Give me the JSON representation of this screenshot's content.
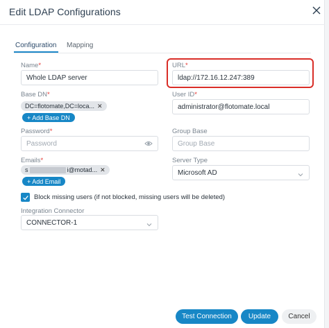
{
  "dialog": {
    "title": "Edit LDAP Configurations",
    "tabs": [
      {
        "label": "Configuration",
        "active": true
      },
      {
        "label": "Mapping",
        "active": false
      }
    ]
  },
  "form": {
    "name": {
      "label": "Name",
      "required_mark": "*",
      "value": "Whole LDAP server"
    },
    "url": {
      "label": "URL",
      "required_mark": "*",
      "value": "ldap://172.16.12.247:389"
    },
    "base_dn": {
      "label": "Base DN",
      "required_mark": "*",
      "chip": "DC=flotomate,DC=loca...",
      "add_label": "+ Add Base DN"
    },
    "user_id": {
      "label": "User ID",
      "required_mark": "*",
      "value": "administrator@flotomate.local"
    },
    "password": {
      "label": "Password",
      "required_mark": "*",
      "placeholder": "Password",
      "icon": "eye-icon"
    },
    "group_base": {
      "label": "Group Base",
      "placeholder": "Group Base"
    },
    "emails": {
      "label": "Emails",
      "required_mark": "*",
      "chip_prefix": "s",
      "chip_suffix": "i@motad...",
      "add_label": "+ Add Email"
    },
    "server_type": {
      "label": "Server Type",
      "value": "Microsoft AD"
    },
    "block_missing": {
      "checked": true,
      "label": "Block missing users (if not blocked, missing users will be deleted)"
    },
    "integration_connector": {
      "label": "Integration Connector",
      "value": "CONNECTOR-1"
    }
  },
  "footer": {
    "test_label": "Test Connection",
    "update_label": "Update",
    "cancel_label": "Cancel"
  },
  "colors": {
    "accent": "#1787c6",
    "highlight": "#d92d27",
    "required": "#e53935"
  }
}
